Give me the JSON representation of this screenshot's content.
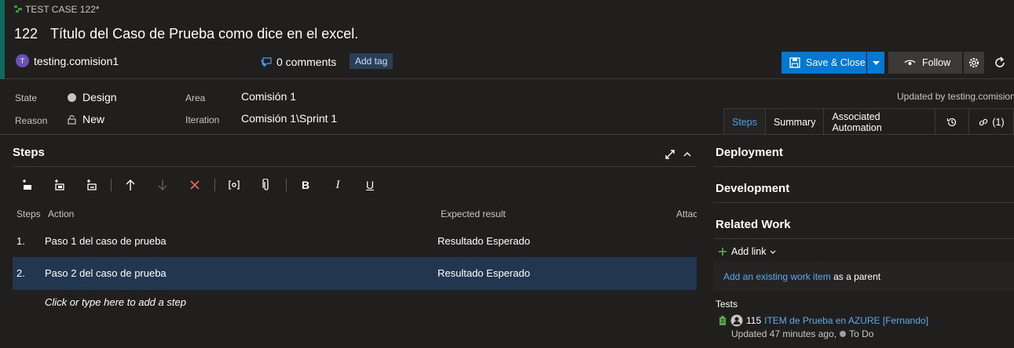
{
  "header": {
    "work_item_type": "TEST CASE 122*",
    "id": "122",
    "title": "Título del Caso de Prueba como dice en el excel.",
    "assigned_user": "testing.comision1",
    "avatar_initial": "T",
    "comments": "0 comments",
    "add_tag": "Add tag",
    "save_close": "Save & Close",
    "follow": "Follow"
  },
  "fields": {
    "state_label": "State",
    "state_value": "Design",
    "reason_label": "Reason",
    "reason_value": "New",
    "area_label": "Area",
    "area_value": "Comisión 1",
    "iteration_label": "Iteration",
    "iteration_value": "Comisión 1\\Sprint 1",
    "updated_by": "Updated by testing.comision"
  },
  "tabs": [
    {
      "label": "Steps",
      "active": true
    },
    {
      "label": "Summary",
      "active": false
    },
    {
      "label": "Associated Automation",
      "active": false
    },
    {
      "label": "",
      "icon": "history-icon",
      "active": false
    },
    {
      "label": "(1)",
      "icon": "link-icon",
      "active": false
    }
  ],
  "steps": {
    "title": "Steps",
    "columns": {
      "steps": "Steps",
      "action": "Action",
      "expected": "Expected result",
      "attachments": "Attac"
    },
    "rows": [
      {
        "num": "1.",
        "action": "Paso 1 del caso de prueba",
        "expected": "Resultado Esperado",
        "selected": false
      },
      {
        "num": "2.",
        "action": "Paso 2 del caso de prueba",
        "expected": "Resultado Esperado",
        "selected": true
      }
    ],
    "add_step": "Click or type here to add a step"
  },
  "right_panel": {
    "deployment": "Deployment",
    "development": "Development",
    "related_work": "Related Work",
    "add_link": "Add link",
    "add_existing_link": "Add an existing work item",
    "add_existing_suffix": " as a parent",
    "tests_label": "Tests",
    "test_id": "115",
    "test_title": "ITEM de Prueba en AZURE [Fernando]",
    "test_updated": "Updated 47 minutes ago,",
    "test_state": "To Do"
  },
  "colors": {
    "accent": "#0078d4",
    "link": "#5ca9f0",
    "selected_row": "#22364f",
    "type_bar": "#0f6b5e"
  }
}
